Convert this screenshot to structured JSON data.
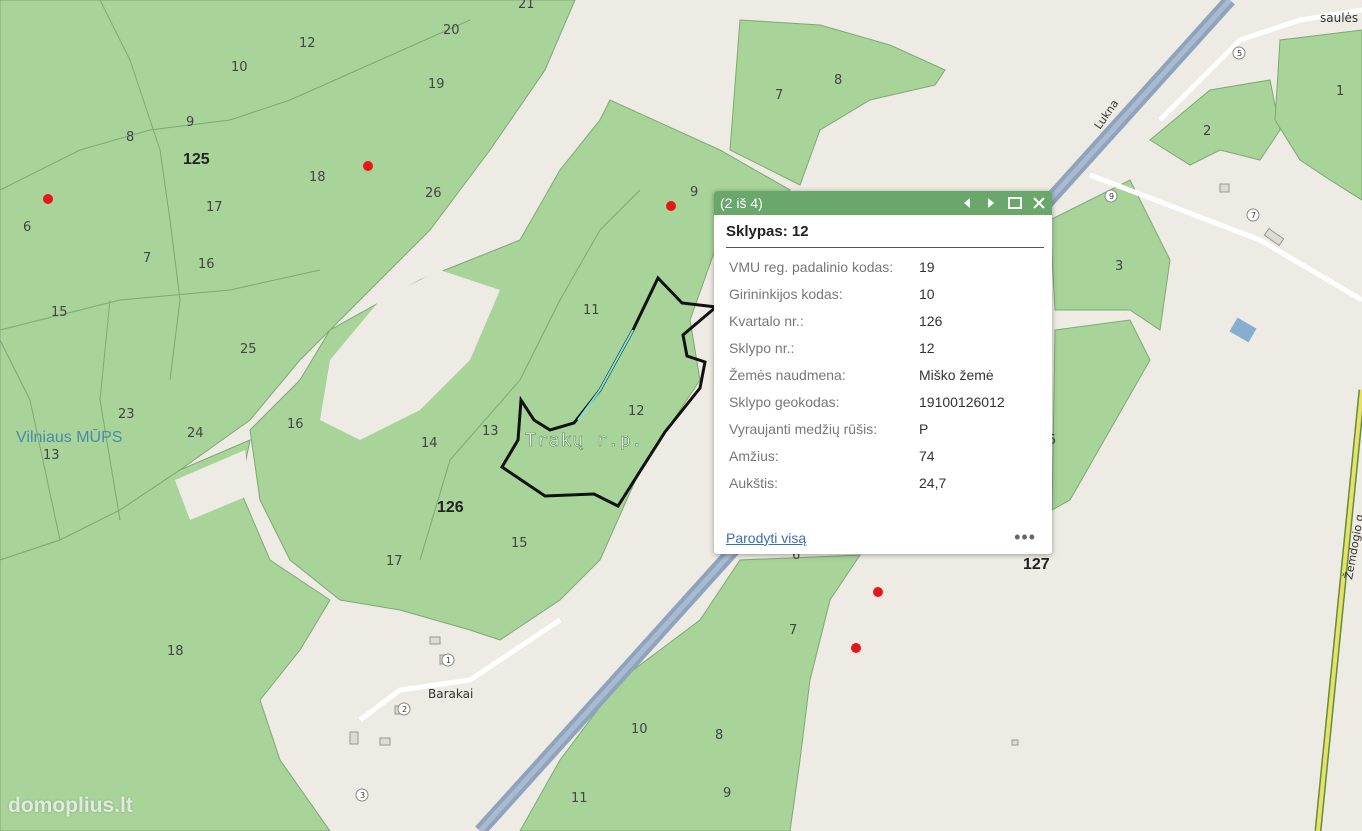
{
  "map": {
    "place_labels": {
      "vilniaus": "Vilniaus MŪPS",
      "traku": "Trakų r.p.",
      "barakai": "Barakai",
      "lukna": "Lukna",
      "saules": "saulės",
      "zemdogis": "Žemdogio g."
    },
    "quarters": [
      "125",
      "126",
      "127"
    ],
    "plots": [
      "21",
      "12",
      "20",
      "10",
      "19",
      "9",
      "8",
      "125",
      "18",
      "26",
      "17",
      "6",
      "7",
      "16",
      "15",
      "25",
      "23",
      "24",
      "13",
      "16",
      "14",
      "13",
      "11",
      "12",
      "126",
      "15",
      "17",
      "18",
      "9",
      "7",
      "8",
      "3",
      "5",
      "1",
      "2",
      "6",
      "7",
      "10",
      "8",
      "11",
      "9",
      "13"
    ],
    "red_points": 5,
    "building_numbers": [
      "1",
      "2",
      "3",
      "5",
      "7",
      "9"
    ]
  },
  "popup": {
    "counter": "(2 iš 4)",
    "title": "Sklypas: 12",
    "attributes": [
      {
        "key": "VMU reg. padalinio kodas:",
        "value": "19"
      },
      {
        "key": "Girininkijos kodas:",
        "value": "10"
      },
      {
        "key": "Kvartalo nr.:",
        "value": "126"
      },
      {
        "key": "Sklypo nr.:",
        "value": "12"
      },
      {
        "key": "Žemės naudmena:",
        "value": "Miško žemė"
      },
      {
        "key": "Sklypo geokodas:",
        "value": "19100126012"
      },
      {
        "key": "Vyraujanti medžių rūšis:",
        "value": "P"
      },
      {
        "key": "Amžius:",
        "value": "74"
      },
      {
        "key": "Aukštis:",
        "value": "24,7"
      }
    ],
    "show_all": "Parodyti visą",
    "more": "•••"
  },
  "watermark": "domoplius.lt",
  "colors": {
    "forest": "#a8d49a",
    "forest_border": "#7ea874",
    "road": "#8fa3bd",
    "header": "#6aa76a",
    "point": "#e8161b"
  }
}
